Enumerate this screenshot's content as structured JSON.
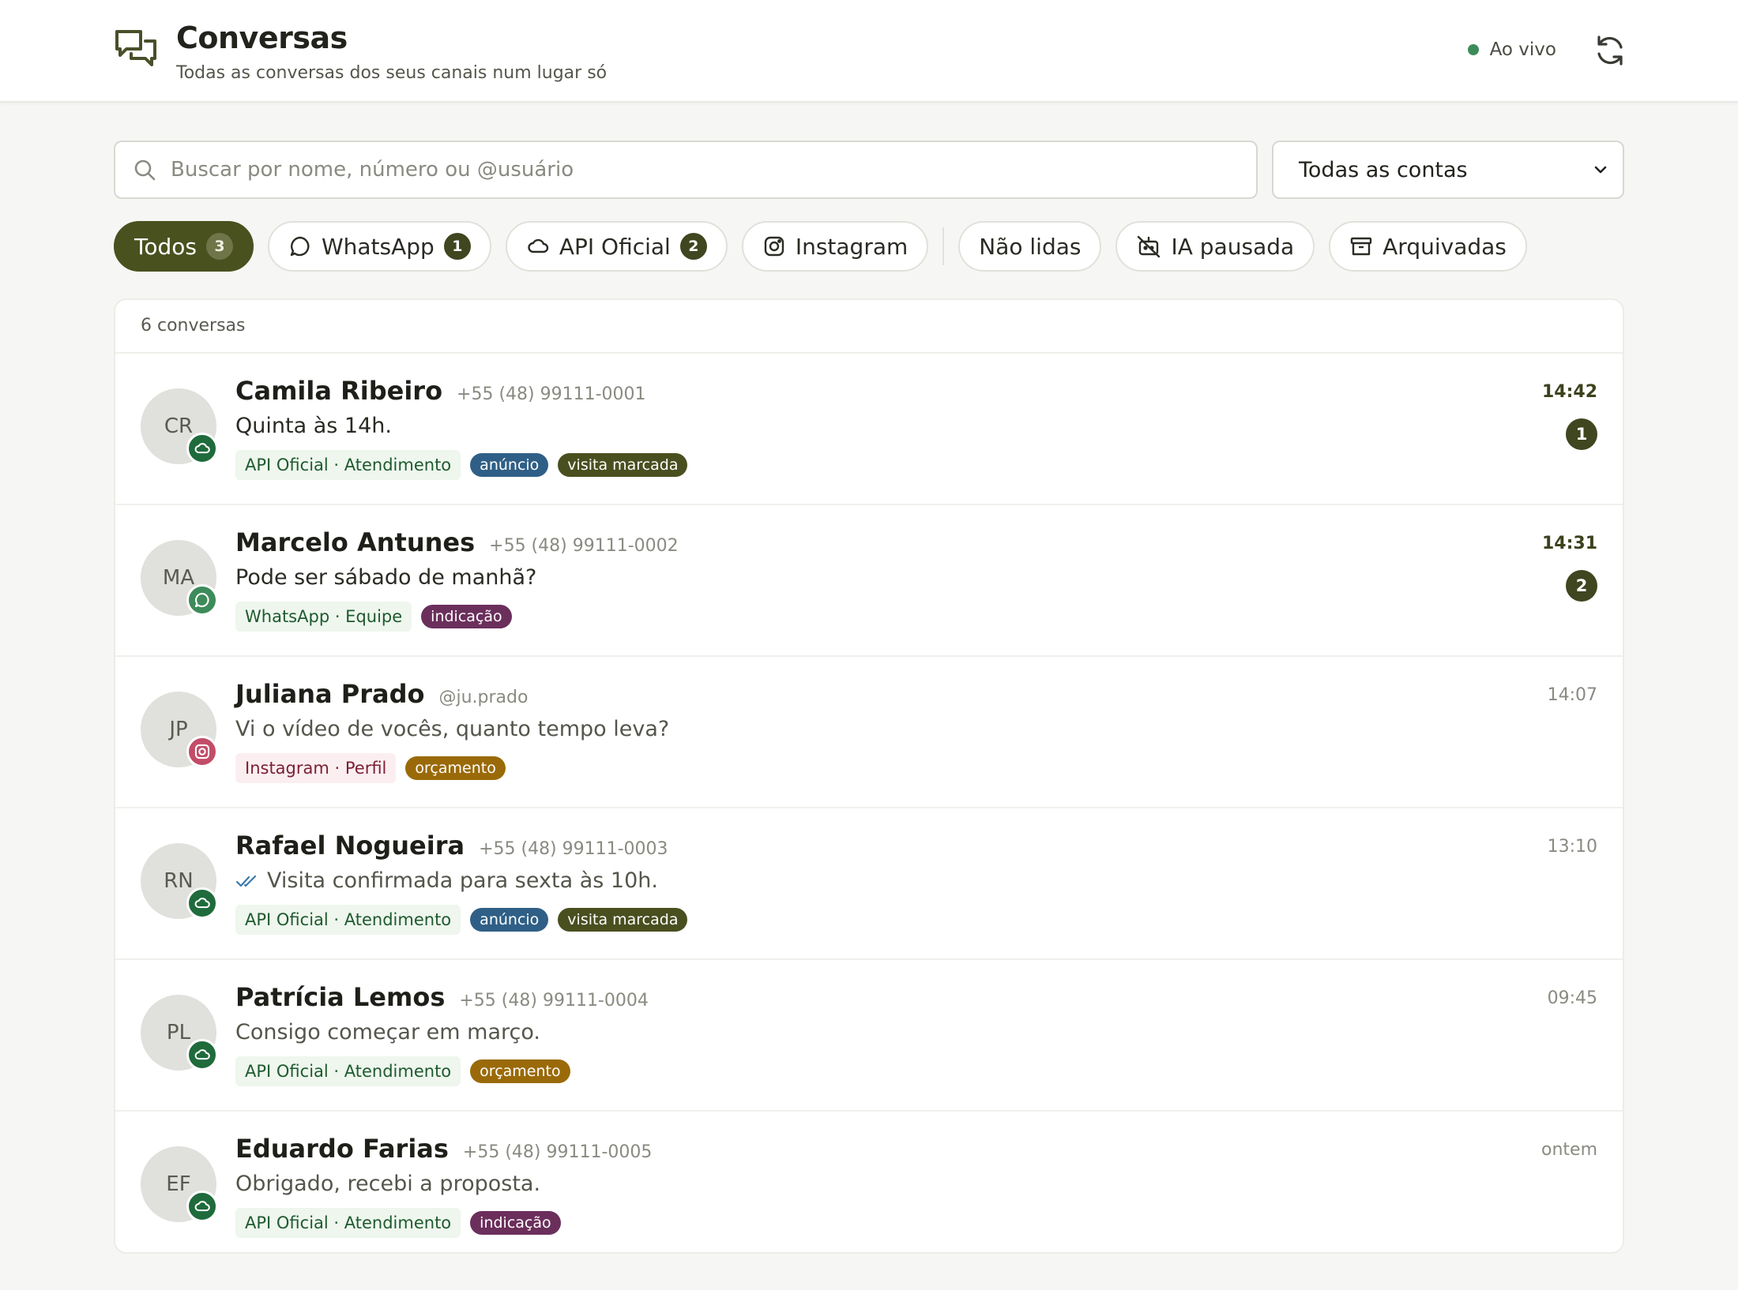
{
  "header": {
    "title": "Conversas",
    "subtitle": "Todas as conversas dos seus canais num lugar só",
    "live_label": "Ao vivo",
    "icon": "chat-bubbles-icon",
    "refresh_icon": "refresh-icon"
  },
  "search": {
    "placeholder": "Buscar por nome, número ou @usuário",
    "value": ""
  },
  "account_select": {
    "selected": "Todas as contas"
  },
  "filters": [
    {
      "label": "Todos",
      "count": "3",
      "active": true
    },
    {
      "label": "WhatsApp",
      "count": "1",
      "icon": "whatsapp-icon"
    },
    {
      "label": "API Oficial",
      "count": "2",
      "icon": "cloud-icon"
    },
    {
      "label": "Instagram",
      "icon": "instagram-icon"
    },
    {
      "label": "Não lidas"
    },
    {
      "label": "IA pausada",
      "icon": "bot-off-icon"
    },
    {
      "label": "Arquivadas",
      "icon": "archive-icon"
    }
  ],
  "list": {
    "count_label": "6 conversas"
  },
  "colors": {
    "accent": "#49511f",
    "tag_anuncio": "#2f5f86",
    "tag_visita": "#4a4f1f",
    "tag_indicacao": "#6b2f5c",
    "tag_orcamento": "#9a6a08",
    "api_badge": "#1f6b3c",
    "whatsapp_badge": "#3d8b5a",
    "instagram_badge": "#c24d68"
  },
  "conversations": [
    {
      "initials": "CR",
      "name": "Camila Ribeiro",
      "handle": "+55 (48) 99111-0001",
      "message": "Quinta às 14h.",
      "source": "API Oficial · Atendimento",
      "channel": "api",
      "tags": [
        "anúncio",
        "visita marcada"
      ],
      "time": "14:42",
      "unread": "1"
    },
    {
      "initials": "MA",
      "name": "Marcelo Antunes",
      "handle": "+55 (48) 99111-0002",
      "message": "Pode ser sábado de manhã?",
      "source": "WhatsApp · Equipe",
      "channel": "whatsapp",
      "tags": [
        "indicação"
      ],
      "time": "14:31",
      "unread": "2"
    },
    {
      "initials": "JP",
      "name": "Juliana Prado",
      "handle": "@ju.prado",
      "message": "Vi o vídeo de vocês, quanto tempo leva?",
      "source": "Instagram · Perfil",
      "channel": "instagram",
      "tags": [
        "orçamento"
      ],
      "time": "14:07"
    },
    {
      "initials": "RN",
      "name": "Rafael Nogueira",
      "handle": "+55 (48) 99111-0003",
      "message": "Visita confirmada para sexta às 10h.",
      "source": "API Oficial · Atendimento",
      "channel": "api",
      "tags": [
        "anúncio",
        "visita marcada"
      ],
      "time": "13:10",
      "read_receipt": true
    },
    {
      "initials": "PL",
      "name": "Patrícia Lemos",
      "handle": "+55 (48) 99111-0004",
      "message": "Consigo começar em março.",
      "source": "API Oficial · Atendimento",
      "channel": "api",
      "tags": [
        "orçamento"
      ],
      "time": "09:45"
    },
    {
      "initials": "EF",
      "name": "Eduardo Farias",
      "handle": "+55 (48) 99111-0005",
      "message": "Obrigado, recebi a proposta.",
      "source": "API Oficial · Atendimento",
      "channel": "api",
      "tags": [
        "indicação"
      ],
      "time": "ontem"
    }
  ]
}
